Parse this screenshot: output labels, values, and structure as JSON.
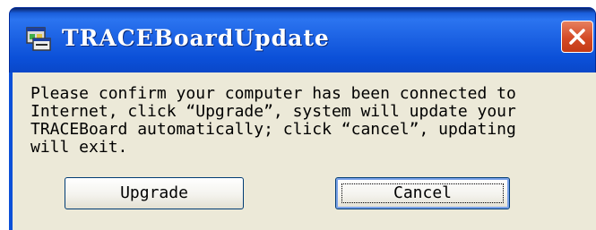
{
  "window": {
    "title": "TRACEBoardUpdate",
    "title_color": "#ffffff",
    "titlebar_color": "#0b50d8",
    "client_color": "#ece9d8",
    "close_button_color": "#d44a26"
  },
  "icons": {
    "app": "app-window-icon",
    "close": "close-x-icon"
  },
  "dialog": {
    "message_lines": [
      "Please confirm your computer has been connected to",
      "Internet, click “Upgrade”, system will update your",
      "TRACEBoard automatically; click “cancel”, updating",
      "will exit."
    ],
    "buttons": {
      "upgrade_label": "Upgrade",
      "cancel_label": "Cancel"
    }
  }
}
